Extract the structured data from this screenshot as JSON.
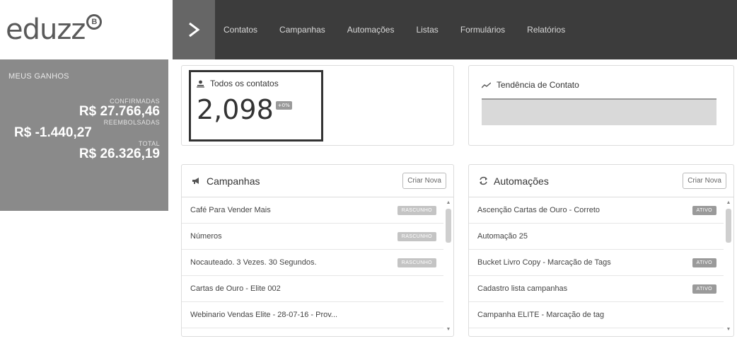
{
  "logo": {
    "text": "eduzz",
    "badge": "B"
  },
  "earnings": {
    "title": "MEUS GANHOS",
    "confirmed_label": "CONFIRMADAS",
    "confirmed_value": "R$ 27.766,46",
    "refunded_label": "REEMBOLSADAS",
    "refunded_value": "R$ -1.440,27",
    "total_label": "TOTAL",
    "total_value": "R$ 26.326,19"
  },
  "nav": {
    "toggle_icon": "chevron-right-icon",
    "items": [
      "Contatos",
      "Campanhas",
      "Automações",
      "Listas",
      "Formulários",
      "Relatórios"
    ]
  },
  "contacts": {
    "title": "Todos os contatos",
    "count": "2,098",
    "badge": "+0%"
  },
  "trend": {
    "title": "Tendência de Contato"
  },
  "campaigns": {
    "title": "Campanhas",
    "button": "Criar Nova",
    "rows": [
      {
        "name": "Café Para Vender Mais",
        "status": "RASCUNHO"
      },
      {
        "name": "Números",
        "status": "RASCUNHO"
      },
      {
        "name": "Nocauteado. 3 Vezes. 30 Segundos.",
        "status": "RASCUNHO"
      },
      {
        "name": "Cartas de Ouro - Elite 002",
        "status": ""
      },
      {
        "name": "Webinario Vendas Elite - 28-07-16 - Prov...",
        "status": ""
      }
    ]
  },
  "automations": {
    "title": "Automações",
    "button": "Criar Nova",
    "rows": [
      {
        "name": "Ascenção Cartas de Ouro - Correto",
        "status": "ATIVO"
      },
      {
        "name": "Automação 25",
        "status": ""
      },
      {
        "name": "Bucket Livro Copy - Marcação de Tags",
        "status": "ATIVO"
      },
      {
        "name": "Cadastro lista campanhas",
        "status": "ATIVO"
      },
      {
        "name": "Campanha ELITE - Marcação de tag",
        "status": ""
      }
    ]
  },
  "colors": {
    "nav_bg": "#3c3c3c",
    "earnings_bg": "#8a8a8a",
    "tag_bg": "#9a9a9a"
  }
}
